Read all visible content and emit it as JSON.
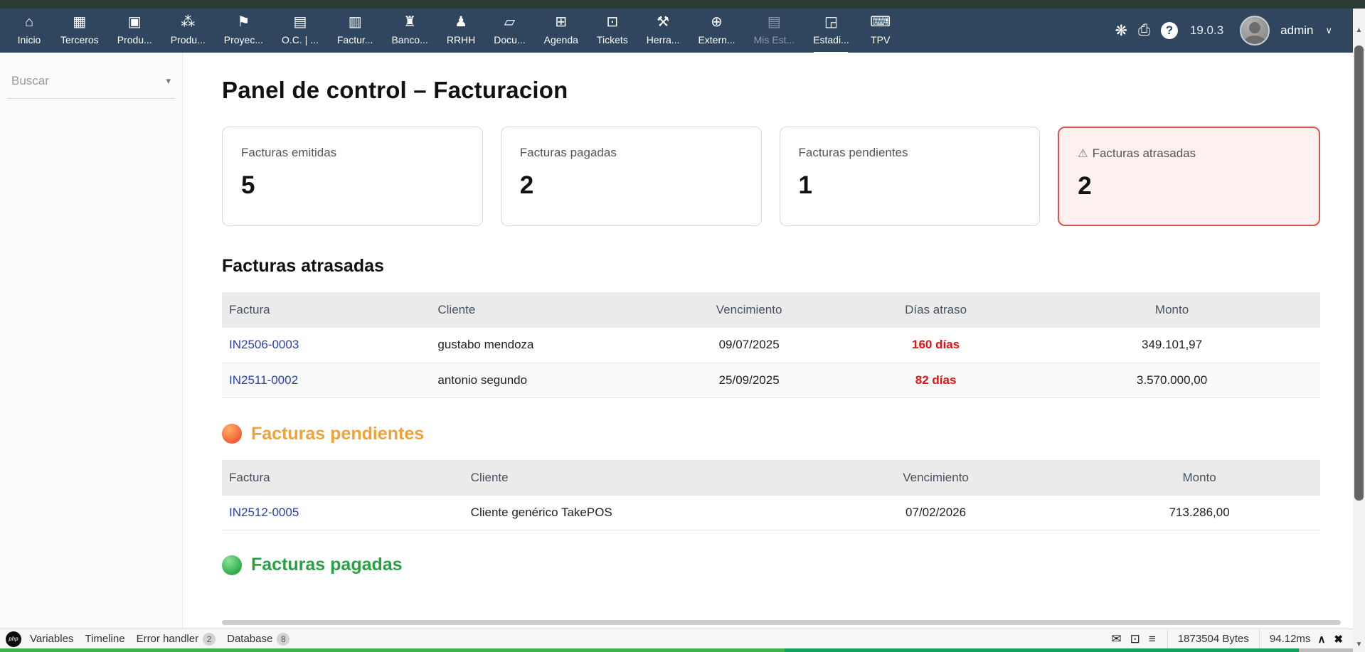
{
  "topbar": {
    "items": [
      {
        "label": "Inicio",
        "icon": "home-icon",
        "glyph": "⌂"
      },
      {
        "label": "Terceros",
        "icon": "thirdparty-icon",
        "glyph": "▦"
      },
      {
        "label": "Produ...",
        "icon": "products-icon",
        "glyph": "▣"
      },
      {
        "label": "Produ...",
        "icon": "mrp-icon",
        "glyph": "⁂"
      },
      {
        "label": "Proyec...",
        "icon": "projects-icon",
        "glyph": "⚑"
      },
      {
        "label": "O.C. | ...",
        "icon": "orders-icon",
        "glyph": "▤"
      },
      {
        "label": "Factur...",
        "icon": "billing-icon",
        "glyph": "▥"
      },
      {
        "label": "Banco...",
        "icon": "bank-icon",
        "glyph": "♜"
      },
      {
        "label": "RRHH",
        "icon": "hr-icon",
        "glyph": "♟"
      },
      {
        "label": "Docu...",
        "icon": "documents-icon",
        "glyph": "▱"
      },
      {
        "label": "Agenda",
        "icon": "calendar-icon",
        "glyph": "⊞"
      },
      {
        "label": "Tickets",
        "icon": "tickets-icon",
        "glyph": "⊡"
      },
      {
        "label": "Herra...",
        "icon": "tools-icon",
        "glyph": "⚒"
      },
      {
        "label": "Extern...",
        "icon": "external-icon",
        "glyph": "⊕"
      },
      {
        "label": "Mis Est...",
        "icon": "mystats-icon",
        "glyph": "▤",
        "disabled": true
      },
      {
        "label": "Estadi...",
        "icon": "stats-icon",
        "glyph": "◲",
        "active": true
      },
      {
        "label": "TPV",
        "icon": "pos-icon",
        "glyph": "⌨"
      }
    ],
    "right": {
      "bug_glyph": "❋",
      "print_glyph": "⎙",
      "help_glyph": "?",
      "version": "19.0.3",
      "username": "admin",
      "caret": "∨"
    }
  },
  "sidebar": {
    "search_label": "Buscar",
    "caret": "▾"
  },
  "page": {
    "title": "Panel de control – Facturacion"
  },
  "cards": [
    {
      "label": "Facturas emitidas",
      "value": "5"
    },
    {
      "label": "Facturas pagadas",
      "value": "2"
    },
    {
      "label": "Facturas pendientes",
      "value": "1"
    },
    {
      "label": "Facturas atrasadas",
      "value": "2",
      "warn_icon": "⚠"
    }
  ],
  "atrasadas": {
    "title": "Facturas atrasadas",
    "headers": {
      "factura": "Factura",
      "cliente": "Cliente",
      "vencimiento": "Vencimiento",
      "dias": "Días atraso",
      "monto": "Monto"
    },
    "rows": [
      {
        "factura": "IN2506-0003",
        "cliente": "gustabo mendoza",
        "vencimiento": "09/07/2025",
        "dias": "160 días",
        "monto": "349.101,97"
      },
      {
        "factura": "IN2511-0002",
        "cliente": "antonio segundo",
        "vencimiento": "25/09/2025",
        "dias": "82 días",
        "monto": "3.570.000,00"
      }
    ]
  },
  "pendientes": {
    "title": "Facturas pendientes",
    "headers": {
      "factura": "Factura",
      "cliente": "Cliente",
      "vencimiento": "Vencimiento",
      "monto": "Monto"
    },
    "rows": [
      {
        "factura": "IN2512-0005",
        "cliente": "Cliente genérico TakePOS",
        "vencimiento": "07/02/2026",
        "monto": "713.286,00"
      }
    ]
  },
  "pagadas": {
    "title": "Facturas pagadas"
  },
  "debugbar": {
    "php_label": "php",
    "variables_label": "Variables",
    "timeline_label": "Timeline",
    "error_handler_label": "Error handler",
    "error_handler_count": "2",
    "database_label": "Database",
    "database_count": "8",
    "mail_glyph": "✉",
    "monitor_glyph": "⊡",
    "db_glyph": "≡",
    "bytes": "1873504 Bytes",
    "time": "94.12ms",
    "collapse_glyph": "∧",
    "close_glyph": "✖"
  },
  "colors": {
    "navbar": "#30465f",
    "alert_border": "#d9534f",
    "alert_bg": "#fdf1f0",
    "green": "#1e8b38",
    "orange": "#f0a43c",
    "red_days": "#e01212",
    "red_value": "#c13838",
    "heading_orange": "#eda33c",
    "heading_green": "#27a143",
    "link_blue": "#2a3eb1"
  }
}
